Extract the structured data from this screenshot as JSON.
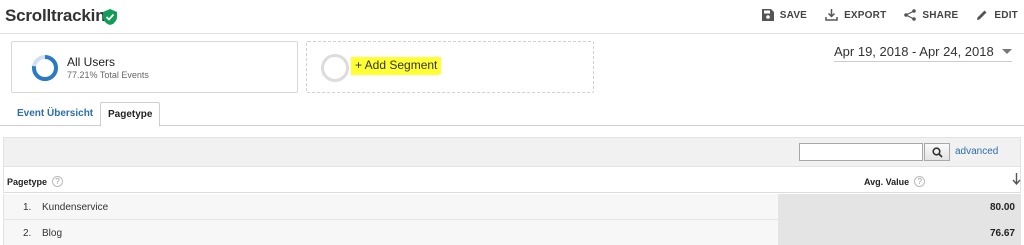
{
  "header": {
    "title": "Scrolltracking",
    "actions": [
      {
        "label": "SAVE",
        "icon": "save-icon"
      },
      {
        "label": "EXPORT",
        "icon": "export-icon"
      },
      {
        "label": "SHARE",
        "icon": "share-icon"
      },
      {
        "label": "EDIT",
        "icon": "edit-icon"
      }
    ]
  },
  "segment": {
    "name": "All Users",
    "subtitle": "77.21% Total Events",
    "percent": 77.21,
    "ring_color": "#2a7bc2"
  },
  "add_segment": {
    "label": "+ Add Segment",
    "highlight_color": "#ffff33"
  },
  "date_range": {
    "label": "Apr 19, 2018 - Apr 24, 2018"
  },
  "tabs": [
    {
      "label": "Event Übersicht",
      "active": false
    },
    {
      "label": "Pagetype",
      "active": true
    }
  ],
  "toolbar": {
    "search_value": "",
    "advanced_label": "advanced"
  },
  "table": {
    "columns": [
      {
        "label": "Pagetype",
        "help": "?"
      },
      {
        "label": "Avg. Value",
        "help": "?"
      }
    ],
    "rows": [
      {
        "index": "1.",
        "name": "Kundenservice",
        "value": "80.00"
      },
      {
        "index": "2.",
        "name": "Blog",
        "value": "76.67"
      }
    ]
  },
  "colors": {
    "link": "#2c6fa9",
    "verified": "#0f9d58"
  }
}
